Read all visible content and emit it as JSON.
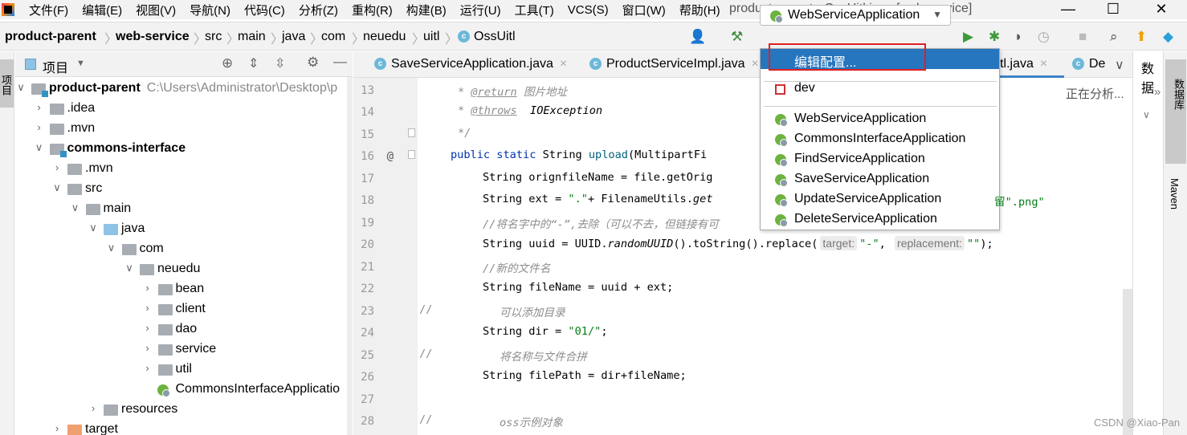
{
  "menu": [
    "文件(F)",
    "编辑(E)",
    "视图(V)",
    "导航(N)",
    "代码(C)",
    "分析(Z)",
    "重构(R)",
    "构建(B)",
    "运行(U)",
    "工具(T)",
    "VCS(S)",
    "窗口(W)",
    "帮助(H)"
  ],
  "window_title": "product-parent - OssUitl.java [web-service]",
  "window_controls": {
    "minimize": "—",
    "maximize": "☐",
    "close": "✕"
  },
  "breadcrumb": [
    "product-parent",
    "web-service",
    "src",
    "main",
    "java",
    "com",
    "neuedu",
    "uitl",
    "OssUitl"
  ],
  "run_config": {
    "selected": "WebServiceApplication",
    "arrow": "▼"
  },
  "toolbar_icons": [
    "user-icon",
    "hammer-icon",
    "run-icon",
    "debug-icon",
    "coverage-icon",
    "profile-icon",
    "stop-icon",
    "search-icon",
    "update-icon",
    "plugin-icon"
  ],
  "left_strip": {
    "label": "项目"
  },
  "project_panel": {
    "title": "项目"
  },
  "tree": [
    {
      "label": "product-parent",
      "path": "C:\\Users\\Administrator\\Desktop\\p",
      "level": 0,
      "state": "open",
      "bold": true,
      "type": "module"
    },
    {
      "label": ".idea",
      "level": 1,
      "state": "closed",
      "type": "folder"
    },
    {
      "label": ".mvn",
      "level": 1,
      "state": "closed",
      "type": "folder"
    },
    {
      "label": "commons-interface",
      "level": 1,
      "state": "open",
      "bold": true,
      "type": "module"
    },
    {
      "label": ".mvn",
      "level": 2,
      "state": "closed",
      "type": "folder"
    },
    {
      "label": "src",
      "level": 2,
      "state": "open",
      "type": "folder"
    },
    {
      "label": "main",
      "level": 3,
      "state": "open",
      "type": "folder"
    },
    {
      "label": "java",
      "level": 4,
      "state": "open",
      "type": "source"
    },
    {
      "label": "com",
      "level": 5,
      "state": "open",
      "type": "package"
    },
    {
      "label": "neuedu",
      "level": 6,
      "state": "open",
      "type": "package"
    },
    {
      "label": "bean",
      "level": 7,
      "state": "closed",
      "type": "package"
    },
    {
      "label": "client",
      "level": 7,
      "state": "closed",
      "type": "package"
    },
    {
      "label": "dao",
      "level": 7,
      "state": "closed",
      "type": "package"
    },
    {
      "label": "service",
      "level": 7,
      "state": "closed",
      "type": "package"
    },
    {
      "label": "util",
      "level": 7,
      "state": "closed",
      "type": "package"
    },
    {
      "label": "CommonsInterfaceApplicatio",
      "level": 7,
      "state": "leaf",
      "type": "spring"
    },
    {
      "label": "resources",
      "level": 4,
      "state": "closed",
      "type": "folder"
    },
    {
      "label": "target",
      "level": 2,
      "state": "closed",
      "type": "excluded"
    }
  ],
  "tabs": [
    {
      "label": "SaveServiceApplication.java",
      "close": "×"
    },
    {
      "label": "ProductServiceImpl.java",
      "close": "×"
    },
    {
      "label": "Uitl.java",
      "close": "×",
      "active": true
    },
    {
      "label": "De"
    }
  ],
  "right_panel": {
    "title": "数据",
    "status": "正在分析...",
    "expand": "»",
    "db_label": "数据库",
    "maven_label": "Maven"
  },
  "code": [
    {
      "n": "13",
      "seg": [
        [
          "cm",
          "* "
        ],
        [
          "tag",
          "@return"
        ],
        [
          "cm",
          " 图片地址"
        ]
      ],
      "indent": 570
    },
    {
      "n": "14",
      "seg": [
        [
          "cm",
          "* "
        ],
        [
          "tag",
          "@throws"
        ],
        [
          "",
          "  "
        ],
        [
          "it",
          "IOException"
        ]
      ],
      "indent": 570
    },
    {
      "n": "15",
      "seg": [
        [
          "cm",
          "*/"
        ]
      ],
      "indent": 570
    },
    {
      "n": "16",
      "gutter": "@",
      "seg": [
        [
          "kw",
          "public static "
        ],
        [
          "",
          "String "
        ],
        [
          "fn",
          "upload"
        ],
        [
          "",
          "(MultipartFi"
        ]
      ],
      "indent": 561
    },
    {
      "n": "17",
      "seg": [
        [
          "",
          "String orignfileName = file.getOrig"
        ]
      ],
      "indent": 601
    },
    {
      "n": "18",
      "seg": [
        [
          "",
          "String ext = "
        ],
        [
          "str",
          "\".\""
        ],
        [
          "",
          "+ FilenameUtils."
        ],
        [
          "it",
          "get"
        ]
      ],
      "indent": 601,
      "tail": [
        [
          "str",
          "留\".png\""
        ]
      ]
    },
    {
      "n": "19",
      "seg": [
        [
          "cm",
          "//将名字中的“-”,去除（可以不去，但链接有可"
        ]
      ],
      "indent": 601
    },
    {
      "n": "20",
      "seg": [
        [
          "",
          "String uuid = UUID."
        ],
        [
          "it",
          "randomUUID"
        ],
        [
          "",
          "().toString().replace("
        ],
        [
          "hint",
          "target:"
        ],
        [
          "str",
          "\"-\""
        ],
        [
          "",
          ", "
        ],
        [
          "hint",
          "replacement:"
        ],
        [
          "str",
          "\"\""
        ],
        [
          "",
          ");"
        ]
      ],
      "indent": 601
    },
    {
      "n": "21",
      "seg": [
        [
          "cm",
          "//新的文件名"
        ]
      ],
      "indent": 601
    },
    {
      "n": "22",
      "seg": [
        [
          "",
          "String fileName = uuid + ext;"
        ]
      ],
      "indent": 601
    },
    {
      "n": "23",
      "comment_prefix": "//",
      "seg": [
        [
          "cm",
          "可以添加目录"
        ]
      ],
      "indent": 622
    },
    {
      "n": "24",
      "seg": [
        [
          "",
          "String dir = "
        ],
        [
          "str",
          "\"01/\""
        ],
        [
          "",
          ";"
        ]
      ],
      "indent": 601
    },
    {
      "n": "25",
      "comment_prefix": "//",
      "seg": [
        [
          "cm",
          "将名称与文件合拼"
        ]
      ],
      "indent": 622
    },
    {
      "n": "26",
      "seg": [
        [
          "",
          "String filePath = dir+fileName;"
        ]
      ],
      "indent": 601
    },
    {
      "n": "27",
      "seg": [],
      "indent": 601
    },
    {
      "n": "28",
      "comment_prefix": "//",
      "seg": [
        [
          "cm",
          "oss示例对象"
        ]
      ],
      "indent": 622
    }
  ],
  "popup": {
    "edit": "编辑配置...",
    "dev": "dev",
    "apps": [
      "WebServiceApplication",
      "CommonsInterfaceApplication",
      "FindServiceApplication",
      "SaveServiceApplication",
      "UpdateServiceApplication",
      "DeleteServiceApplication"
    ]
  },
  "watermark": "CSDN @Xiao-Pan",
  "colors": {
    "accent": "#2675bf",
    "highlight_box": "#e02020",
    "string": "#067d17",
    "keyword": "#0033b3"
  }
}
